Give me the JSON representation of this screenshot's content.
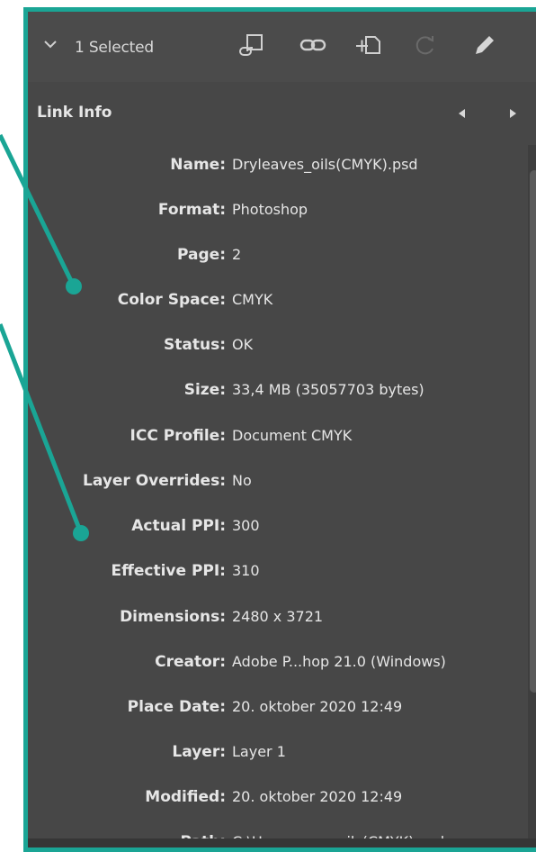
{
  "header": {
    "selection_label": "1 Selected",
    "icons": [
      "relink-from-folder-icon",
      "chain-link-icon",
      "relink-icon",
      "update-link-icon",
      "edit-original-icon"
    ]
  },
  "panel": {
    "title": "Link Info",
    "border_color": "#1aa595",
    "background": "#474747"
  },
  "info": [
    {
      "key": "Name:",
      "value": "Dryleaves_oils(CMYK).psd"
    },
    {
      "key": "Format:",
      "value": "Photoshop"
    },
    {
      "key": "Page:",
      "value": "2"
    },
    {
      "key": "Color Space:",
      "value": "CMYK"
    },
    {
      "key": "Status:",
      "value": "OK"
    },
    {
      "key": "Size:",
      "value": "33,4 MB (35057703 bytes)"
    },
    {
      "key": "ICC Profile:",
      "value": "Document CMYK"
    },
    {
      "key": "Layer Overrides:",
      "value": "No"
    },
    {
      "key": "Actual PPI:",
      "value": "300"
    },
    {
      "key": "Effective PPI:",
      "value": "310"
    },
    {
      "key": "Dimensions:",
      "value": "2480 x 3721"
    },
    {
      "key": "Creator:",
      "value": "Adobe P...hop 21.0 (Windows)"
    },
    {
      "key": "Place Date:",
      "value": "20. oktober 2020 12:49"
    },
    {
      "key": "Layer:",
      "value": "Layer 1"
    },
    {
      "key": "Modified:",
      "value": "20. oktober 2020 12:49"
    },
    {
      "key": "Path:",
      "value": "C:\\User...aves_oils(CMYK).psd"
    }
  ],
  "annotation_color": "#1aa595"
}
